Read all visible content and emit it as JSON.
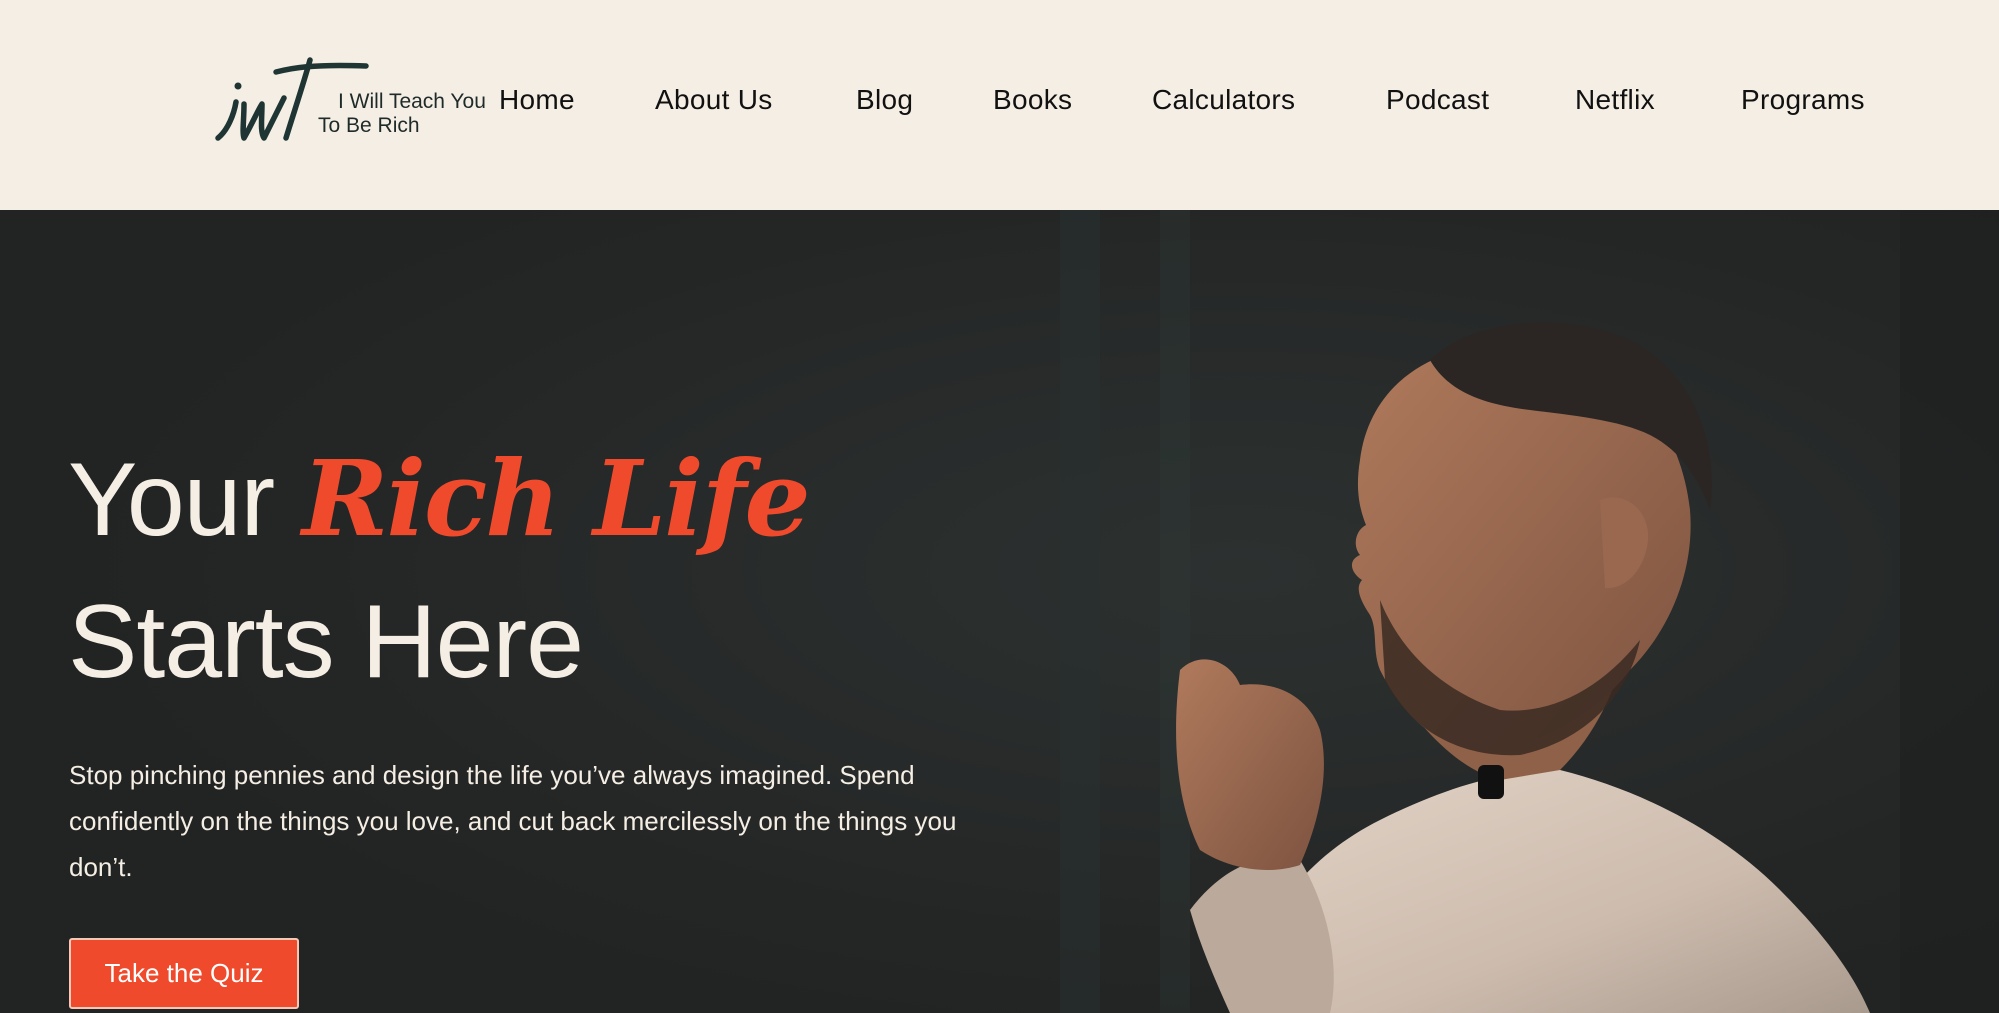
{
  "logo": {
    "monogram": "iwt",
    "line1": "I Will Teach You",
    "line2": "To Be Rich"
  },
  "nav": {
    "items": [
      {
        "label": "Home"
      },
      {
        "label": "About Us"
      },
      {
        "label": "Blog"
      },
      {
        "label": "Books"
      },
      {
        "label": "Calculators"
      },
      {
        "label": "Podcast"
      },
      {
        "label": "Netflix"
      },
      {
        "label": "Programs"
      }
    ]
  },
  "hero": {
    "headline_part1": "Your ",
    "headline_accent": "Rich Life",
    "headline_part2": "Starts Here",
    "subtext": "Stop pinching pennies and design the life you’ve always imagined. Spend confidently on the things you love, and cut back mercilessly on the things you don’t.",
    "cta_label": "Take the Quiz",
    "image": "speaker-photo"
  },
  "colors": {
    "header_bg": "#f5eee4",
    "hero_bg": "#242525",
    "accent": "#f04a2c",
    "text_light": "#f5eee4",
    "logo_dark": "#1f2b2a"
  }
}
